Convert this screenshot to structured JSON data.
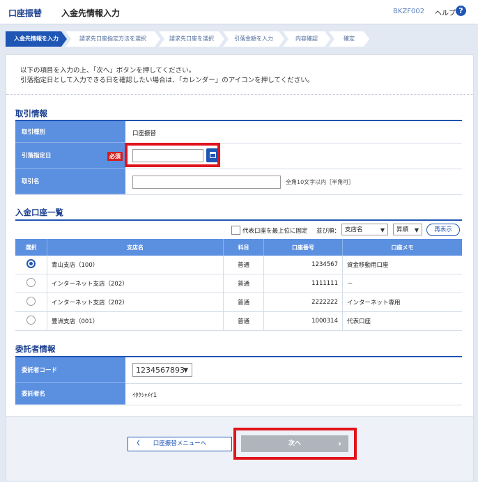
{
  "header": {
    "category": "口座振替",
    "title": "入金先情報入力",
    "screen_id": "BKZF002",
    "help_label": "ヘルプ",
    "help_icon": "?"
  },
  "steps": [
    {
      "label": "入金先情報を入力",
      "active": true
    },
    {
      "label": "請求先口座指定方法を選択",
      "active": false
    },
    {
      "label": "請求先口座を選択",
      "active": false
    },
    {
      "label": "引落金額を入力",
      "active": false
    },
    {
      "label": "内容確認",
      "active": false
    },
    {
      "label": "確定",
      "active": false
    }
  ],
  "intro": {
    "line1": "以下の項目を入力の上、「次へ」ボタンを押してください。",
    "line2": "引落指定日として入力できる日を確認したい場合は、「カレンダー」のアイコンを押してください。"
  },
  "transaction": {
    "section_title": "取引情報",
    "type_label": "取引種別",
    "type_value": "口座振替",
    "date_label": "引落指定日",
    "required_badge": "必須",
    "date_value": "",
    "name_label": "取引名",
    "name_value": "",
    "name_hint": "全角10文字以内［半角可］"
  },
  "accounts": {
    "section_title": "入金口座一覧",
    "rep_checkbox_label": "代表口座を最上位に固定",
    "sort_label": "並び順：",
    "sort_field": "支店名",
    "sort_order": "昇順",
    "redisplay_label": "再表示",
    "columns": [
      "選択",
      "支店名",
      "科目",
      "口座番号",
      "口座メモ"
    ],
    "rows": [
      {
        "selected": true,
        "branch": "青山支店（100）",
        "type": "普通",
        "number": "1234567",
        "memo": "資金移動用口座"
      },
      {
        "selected": false,
        "branch": "インターネット支店（202）",
        "type": "普通",
        "number": "1111111",
        "memo": "－"
      },
      {
        "selected": false,
        "branch": "インターネット支店（202）",
        "type": "普通",
        "number": "2222222",
        "memo": "インターネット専用"
      },
      {
        "selected": false,
        "branch": "豊洲支店（001）",
        "type": "普通",
        "number": "1000314",
        "memo": "代表口座"
      }
    ]
  },
  "consignor": {
    "section_title": "委託者情報",
    "code_label": "委託者コード",
    "code_value": "1234567893",
    "name_label": "委託者名",
    "name_value": "ｲﾀｸｼｬﾒｲ1"
  },
  "buttons": {
    "back_label": "口座振替メニューへ",
    "next_label": "次へ"
  },
  "colors": {
    "brand_blue": "#1f55b5",
    "label_blue": "#5b8fe0",
    "highlight_red": "#e0141c",
    "disabled_gray": "#b0b5bd"
  }
}
